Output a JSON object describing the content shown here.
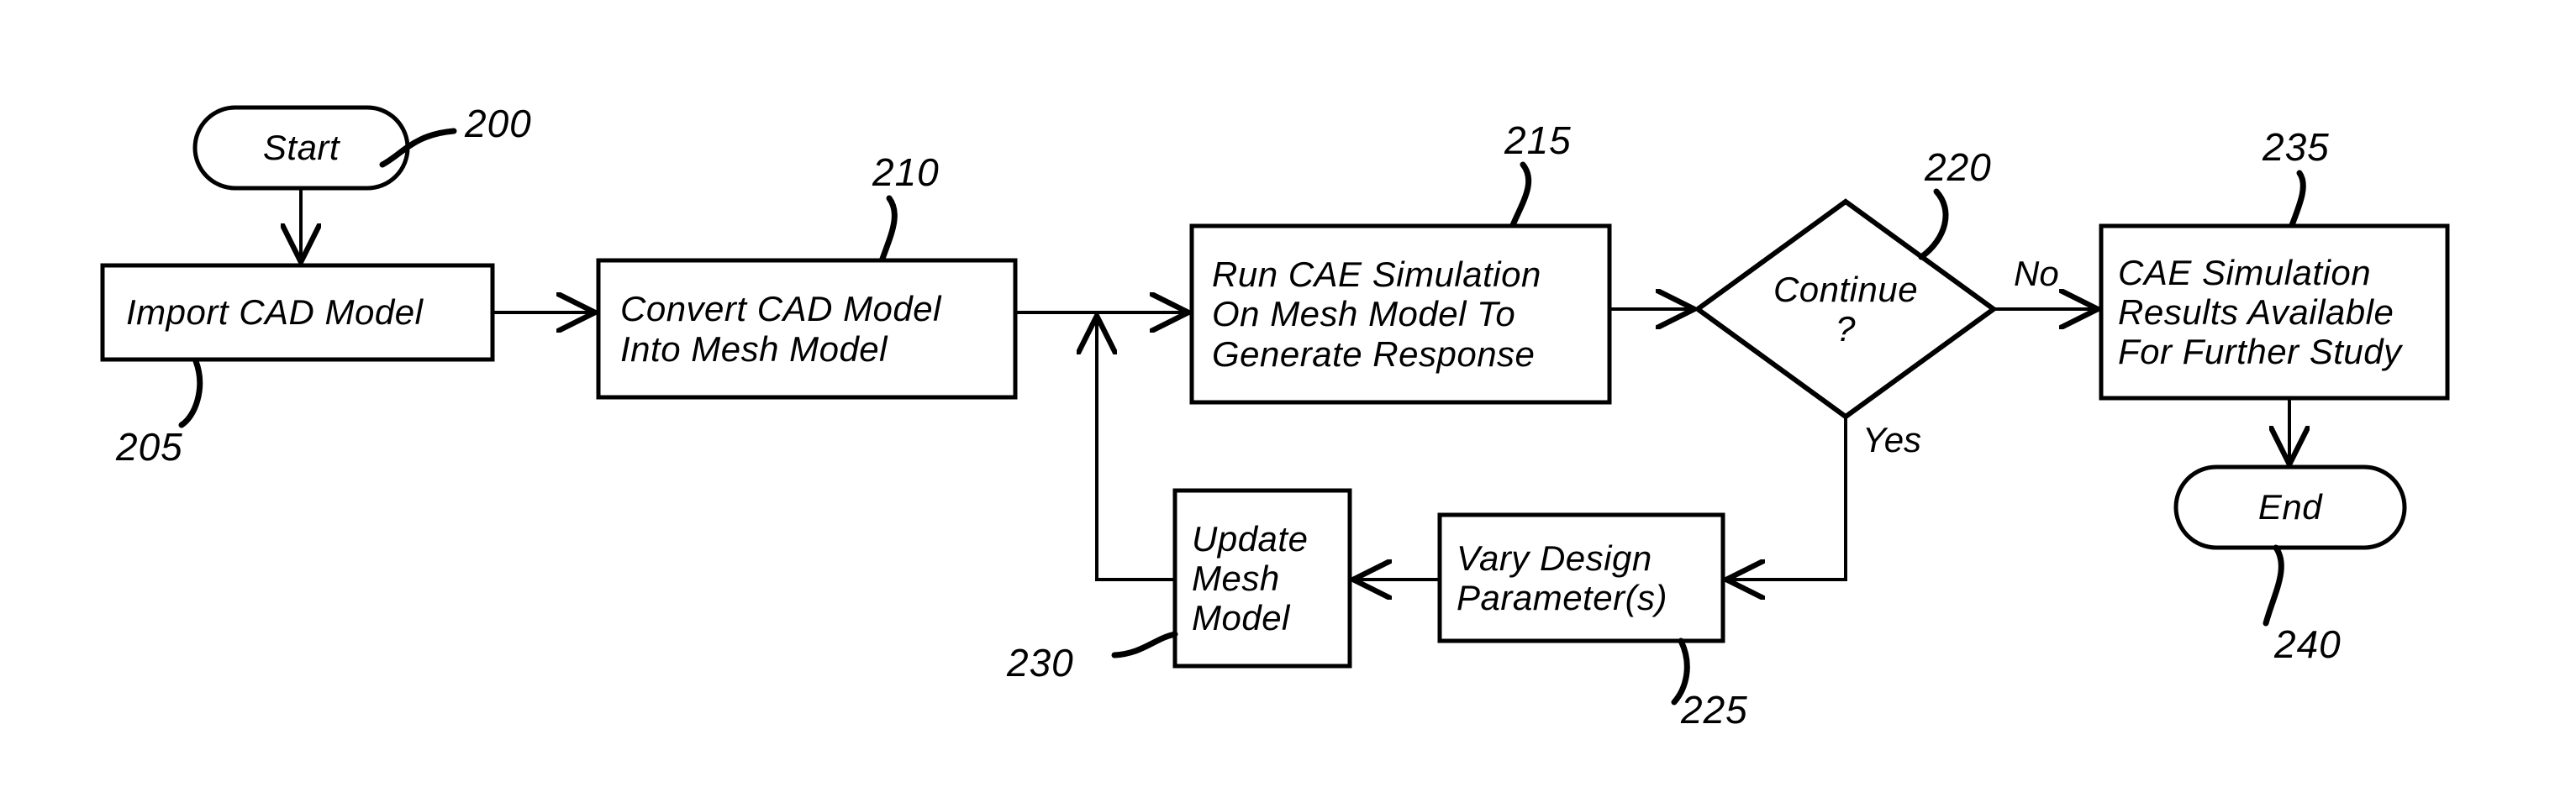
{
  "figure": {
    "type": "patent-flowchart",
    "background": "#ffffff",
    "stroke": "#000000"
  },
  "nodes": {
    "start": {
      "shape": "terminal",
      "label": "Start",
      "ref": "200"
    },
    "import_cad": {
      "shape": "process",
      "lines": [
        "Import CAD Model"
      ],
      "ref": "205"
    },
    "convert_cad": {
      "shape": "process",
      "lines": [
        "Convert CAD Model",
        "Into Mesh Model"
      ],
      "ref": "210"
    },
    "run_cae": {
      "shape": "process",
      "lines": [
        "Run CAE Simulation",
        "On Mesh Model To",
        "Generate Response"
      ],
      "ref": "215"
    },
    "continue_decision": {
      "shape": "decision",
      "lines": [
        "Continue",
        "?"
      ],
      "ref": "220"
    },
    "results": {
      "shape": "process",
      "lines": [
        "CAE Simulation",
        "Results Available",
        "For Further Study"
      ],
      "ref": "235"
    },
    "end": {
      "shape": "terminal",
      "label": "End",
      "ref": "240"
    },
    "vary_design": {
      "shape": "process",
      "lines": [
        "Vary Design",
        "Parameter(s)"
      ],
      "ref": "225"
    },
    "update_mesh": {
      "shape": "process",
      "lines": [
        "Update",
        "Mesh",
        "Model"
      ],
      "ref": "230"
    }
  },
  "edge_labels": {
    "no_branch": "No",
    "yes_branch": "Yes"
  },
  "reference_numerals": {
    "start": "200",
    "import_cad": "205",
    "convert_cad": "210",
    "run_cae": "215",
    "continue_decision": "220",
    "vary_design": "225",
    "update_mesh": "230",
    "results": "235",
    "end": "240"
  }
}
